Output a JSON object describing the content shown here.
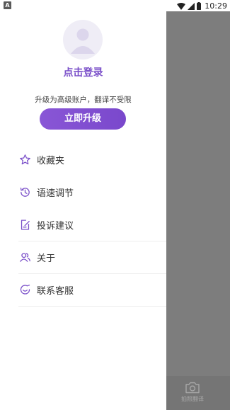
{
  "status_bar": {
    "app_badge": "A",
    "time": "10:29",
    "icons": [
      "wifi-icon",
      "signal-icon",
      "battery-icon"
    ]
  },
  "drawer": {
    "login_text": "点击登录",
    "upgrade_hint": "升级为高级账户，翻译不受限",
    "upgrade_button": "立即升级",
    "menu": [
      {
        "label": "收藏夹",
        "icon": "star-icon"
      },
      {
        "label": "语速调节",
        "icon": "history-icon"
      },
      {
        "label": "投诉建议",
        "icon": "feedback-icon"
      },
      {
        "label": "关于",
        "icon": "people-icon"
      },
      {
        "label": "联系客服",
        "icon": "customer-service-icon"
      }
    ]
  },
  "background_app": {
    "tab_label": "拍照翻译",
    "tab_icon": "camera-icon"
  },
  "colors": {
    "accent": "#7a4fc9",
    "overlay": "#7d7d7d"
  }
}
